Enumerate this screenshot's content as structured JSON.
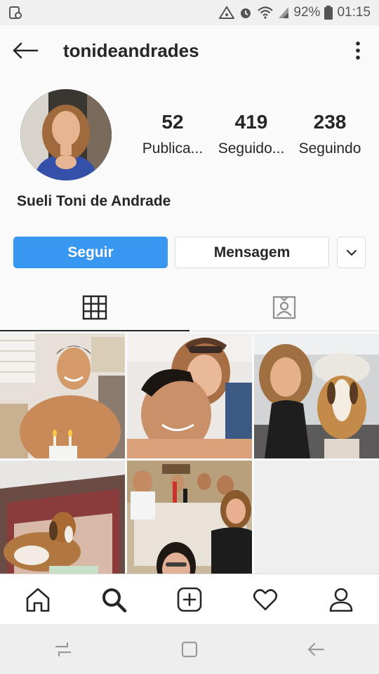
{
  "status_bar": {
    "battery": "92%",
    "time": "01:15"
  },
  "header": {
    "username": "tonideandrades"
  },
  "profile": {
    "posts": {
      "count": "52",
      "label": "Publica..."
    },
    "followers": {
      "count": "419",
      "label": "Seguido..."
    },
    "following": {
      "count": "238",
      "label": "Seguindo"
    },
    "full_name": "Sueli Toni de Andrade"
  },
  "actions": {
    "follow_label": "Seguir",
    "message_label": "Mensagem"
  },
  "tabs": [
    {
      "icon": "grid-icon",
      "active": true
    },
    {
      "icon": "tagged-icon",
      "active": false
    }
  ],
  "posts": [
    {
      "subject": "man with birthday candles"
    },
    {
      "subject": "selfie man and woman"
    },
    {
      "subject": "woman with beagle in car"
    },
    {
      "subject": "beagle in dog bed"
    },
    {
      "subject": "family dinner selfie"
    }
  ],
  "bottom_nav": [
    "home-icon",
    "search-icon",
    "add-post-icon",
    "activity-heart-icon",
    "profile-icon"
  ],
  "colors": {
    "accent": "#3897f0",
    "text": "#262626",
    "border": "#dbdbdb",
    "background": "#fafafa"
  }
}
